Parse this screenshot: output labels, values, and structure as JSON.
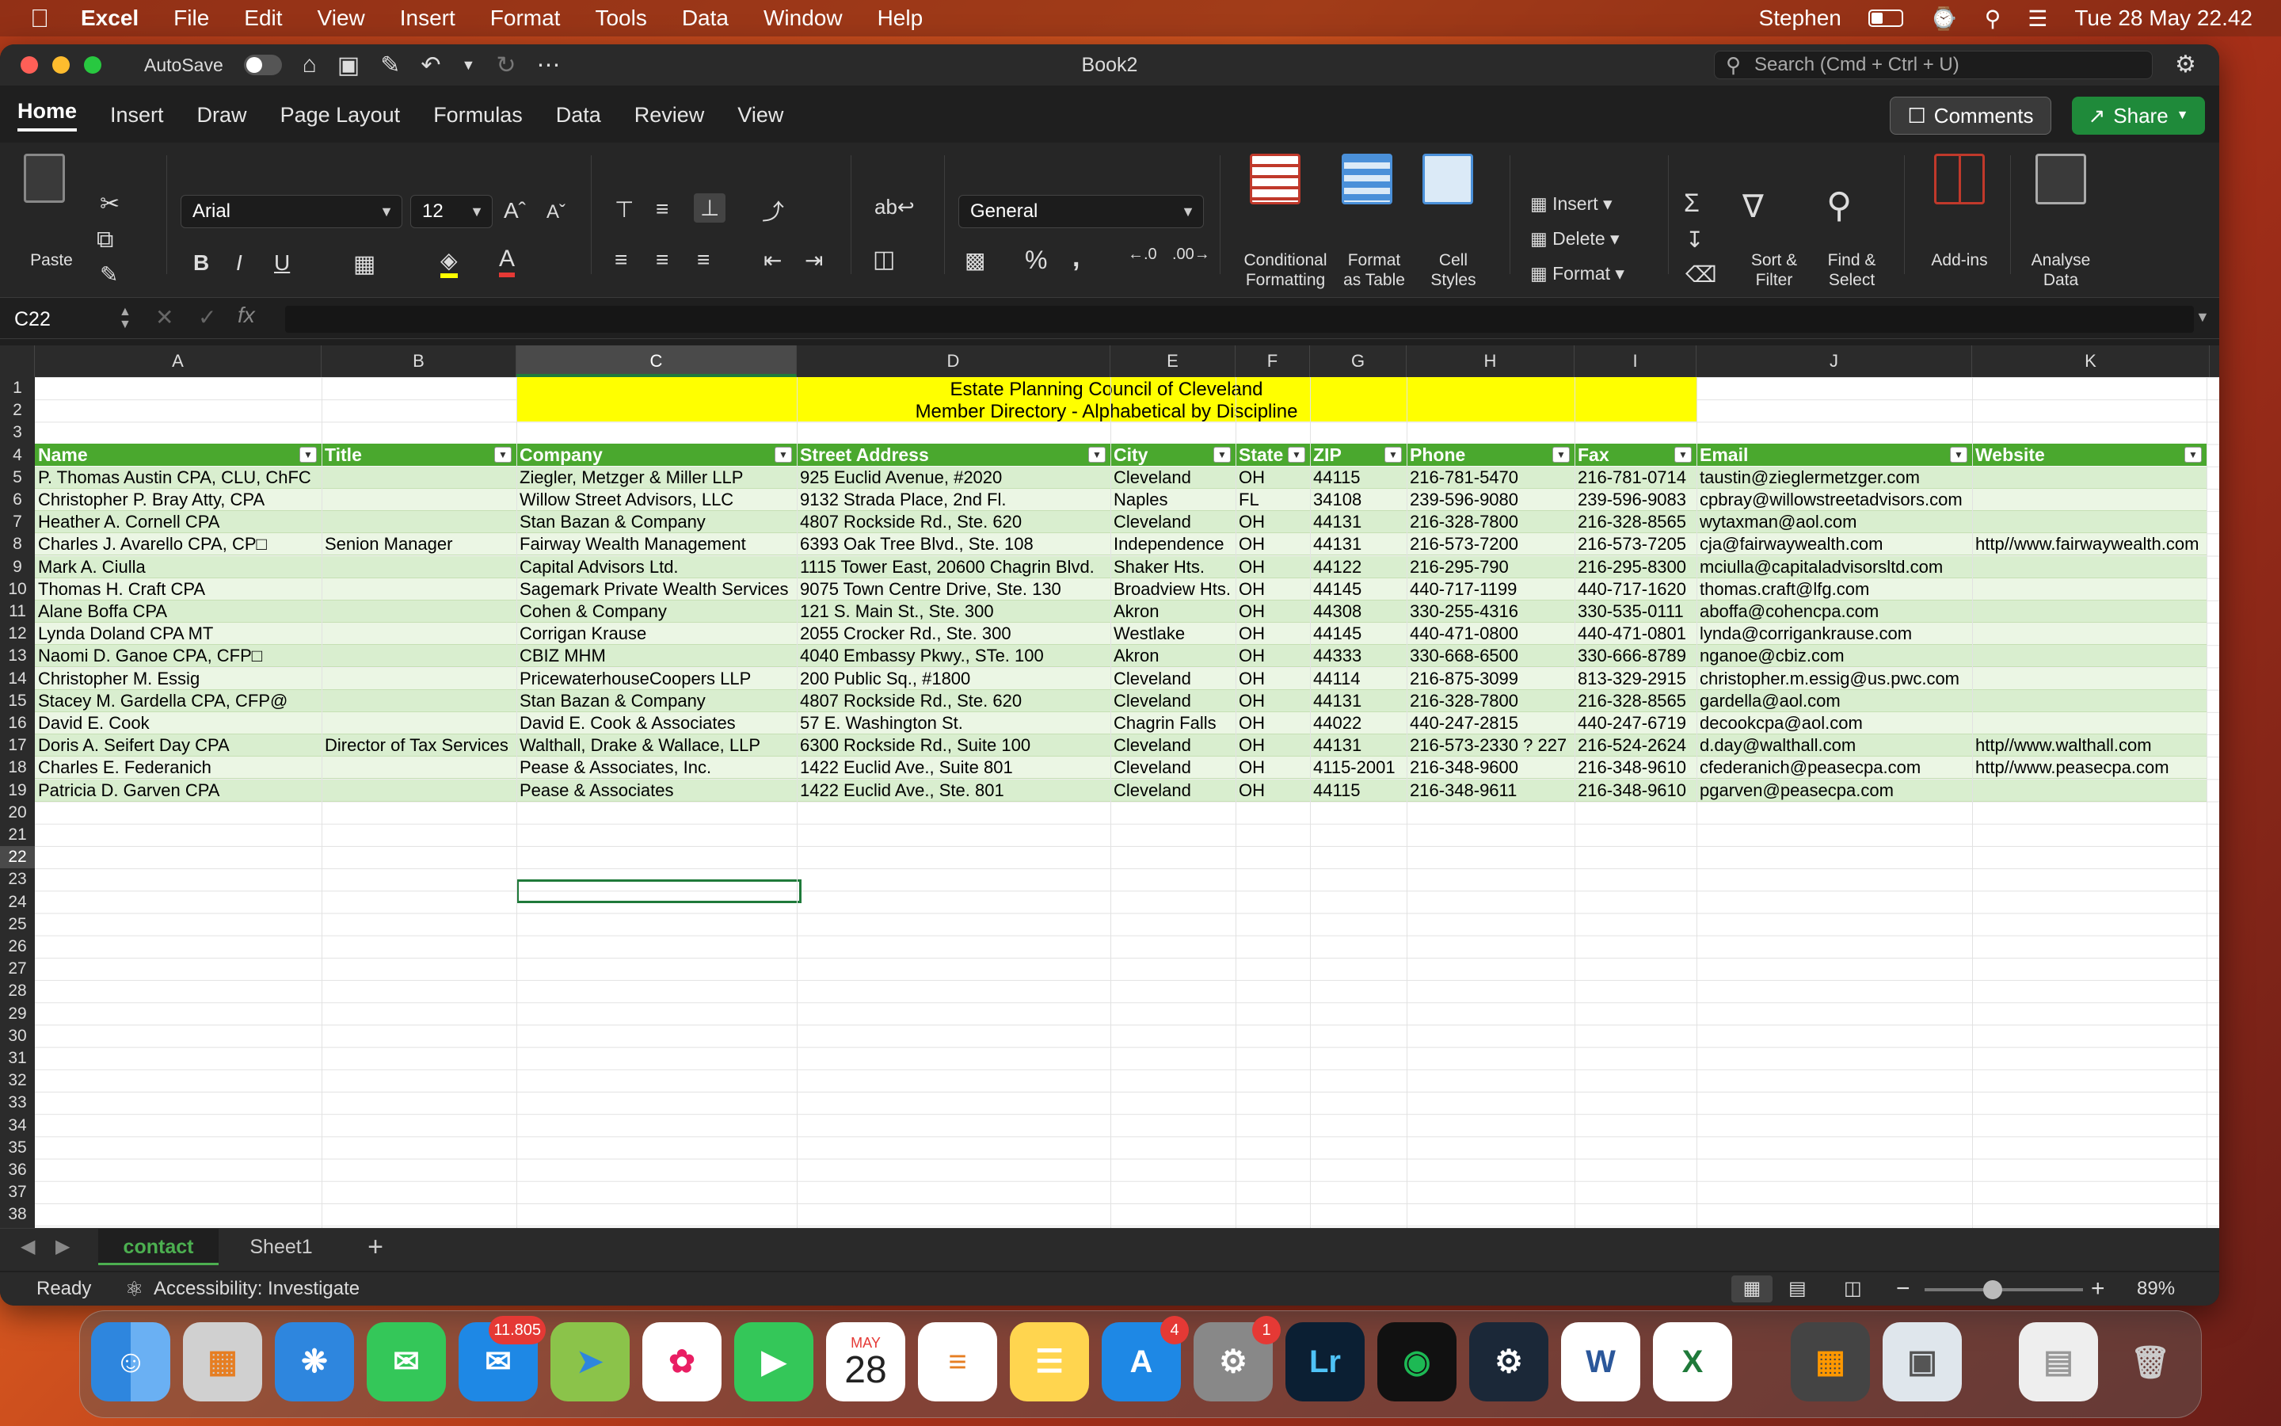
{
  "menubar": {
    "app": "Excel",
    "items": [
      "File",
      "Edit",
      "View",
      "Insert",
      "Format",
      "Tools",
      "Data",
      "Window",
      "Help"
    ],
    "user": "Stephen",
    "datetime": "Tue 28 May  22.42"
  },
  "window": {
    "autosave": "AutoSave",
    "title": "Book2",
    "search_placeholder": "Search (Cmd + Ctrl + U)"
  },
  "tabs": [
    "Home",
    "Insert",
    "Draw",
    "Page Layout",
    "Formulas",
    "Data",
    "Review",
    "View"
  ],
  "actions": {
    "comments": "Comments",
    "share": "Share"
  },
  "ribbon": {
    "paste": "Paste",
    "font": "Arial",
    "size": "12",
    "number_format": "General",
    "conditional": [
      "Conditional",
      "Formatting"
    ],
    "format_table": [
      "Format",
      "as Table"
    ],
    "cell_styles": [
      "Cell",
      "Styles"
    ],
    "insert": "Insert",
    "delete": "Delete",
    "format": "Format",
    "sort": [
      "Sort &",
      "Filter"
    ],
    "find": [
      "Find &",
      "Select"
    ],
    "addins": "Add-ins",
    "analyse": [
      "Analyse",
      "Data"
    ]
  },
  "formula": {
    "cell": "C22",
    "fx": "fx"
  },
  "columns": [
    "A",
    "B",
    "C",
    "D",
    "E",
    "F",
    "G",
    "H",
    "I",
    "J",
    "K"
  ],
  "banner": {
    "line1": "Estate Planning Council of Cleveland",
    "line2": "Member Directory - Alphabetical by Discipline"
  },
  "headers": [
    "Name",
    "Title",
    "Company",
    "Street Address",
    "City",
    "State",
    "ZIP",
    "Phone",
    "Fax",
    "Email",
    "Website"
  ],
  "rows": [
    [
      "P. Thomas Austin CPA, CLU, ChFC",
      "",
      "Ziegler, Metzger & Miller LLP",
      "925 Euclid Avenue, #2020",
      "Cleveland",
      "OH",
      "44115",
      "216-781-5470",
      "216-781-0714",
      "taustin@zieglermetzger.com",
      ""
    ],
    [
      "Christopher P. Bray Atty, CPA",
      "",
      "Willow Street Advisors, LLC",
      "9132 Strada Place, 2nd Fl.",
      "Naples",
      "FL",
      "34108",
      "239-596-9080",
      "239-596-9083",
      "cpbray@willowstreetadvisors.com",
      ""
    ],
    [
      "Heather A. Cornell CPA",
      "",
      "Stan Bazan & Company",
      "4807 Rockside Rd., Ste. 620",
      "Cleveland",
      "OH",
      "44131",
      "216-328-7800",
      "216-328-8565",
      "wytaxman@aol.com",
      ""
    ],
    [
      "Charles J. Avarello CPA, CP□",
      "Senion Manager",
      "Fairway Wealth Management",
      "6393 Oak Tree Blvd., Ste. 108",
      "Independence",
      "OH",
      "44131",
      "216-573-7200",
      "216-573-7205",
      "cja@fairwaywealth.com",
      "http//www.fairwaywealth.com"
    ],
    [
      "Mark A. Ciulla",
      "",
      "Capital Advisors Ltd.",
      "1115 Tower East, 20600 Chagrin Blvd.",
      "Shaker Hts.",
      "OH",
      "44122",
      "216-295-790",
      "216-295-8300",
      "mciulla@capitaladvisorsltd.com",
      ""
    ],
    [
      "Thomas H. Craft CPA",
      "",
      "Sagemark Private Wealth Services",
      "9075 Town Centre Drive, Ste. 130",
      "Broadview Hts.",
      "OH",
      "44145",
      "440-717-1199",
      "440-717-1620",
      "thomas.craft@lfg.com",
      ""
    ],
    [
      "Alane Boffa CPA",
      "",
      "Cohen & Company",
      "121 S. Main St., Ste. 300",
      "Akron",
      "OH",
      "44308",
      "330-255-4316",
      "330-535-0111",
      "aboffa@cohencpa.com",
      ""
    ],
    [
      "Lynda Doland CPA MT",
      "",
      "Corrigan Krause",
      "2055 Crocker Rd., Ste. 300",
      "Westlake",
      "OH",
      "44145",
      "440-471-0800",
      "440-471-0801",
      "lynda@corrigankrause.com",
      ""
    ],
    [
      "Naomi D. Ganoe CPA, CFP□",
      "",
      "CBIZ MHM",
      "4040 Embassy Pkwy., STe. 100",
      "Akron",
      "OH",
      "44333",
      "330-668-6500",
      "330-666-8789",
      "nganoe@cbiz.com",
      ""
    ],
    [
      "Christopher M. Essig",
      "",
      "PricewaterhouseCoopers LLP",
      "200 Public Sq., #1800",
      "Cleveland",
      "OH",
      "44114",
      "216-875-3099",
      "813-329-2915",
      "christopher.m.essig@us.pwc.com",
      ""
    ],
    [
      "Stacey M. Gardella CPA, CFP@",
      "",
      "Stan Bazan & Company",
      "4807 Rockside Rd., Ste. 620",
      "Cleveland",
      "OH",
      "44131",
      "216-328-7800",
      "216-328-8565",
      "gardella@aol.com",
      ""
    ],
    [
      "David E. Cook",
      "",
      "David E. Cook & Associates",
      "57 E. Washington St.",
      "Chagrin Falls",
      "OH",
      "44022",
      "440-247-2815",
      "440-247-6719",
      "decookcpa@aol.com",
      ""
    ],
    [
      "Doris A. Seifert Day CPA",
      "Director of Tax Services",
      "Walthall, Drake & Wallace, LLP",
      "6300 Rockside Rd., Suite 100",
      "Cleveland",
      "OH",
      "44131",
      "216-573-2330 ? 227",
      "216-524-2624",
      "d.day@walthall.com",
      "http//www.walthall.com"
    ],
    [
      "Charles E. Federanich",
      "",
      "Pease & Associates, Inc.",
      "1422 Euclid Ave., Suite 801",
      "Cleveland",
      "OH",
      "4115-2001",
      "216-348-9600",
      "216-348-9610",
      "cfederanich@peasecpa.com",
      "http//www.peasecpa.com"
    ],
    [
      "Patricia D. Garven CPA",
      "",
      "Pease & Associates",
      "1422 Euclid Ave., Ste. 801",
      "Cleveland",
      "OH",
      "44115",
      "216-348-9611",
      "216-348-9610",
      "pgarven@peasecpa.com",
      ""
    ]
  ],
  "sheets": [
    "contact",
    "Sheet1"
  ],
  "status": {
    "ready": "Ready",
    "accessibility": "Accessibility: Investigate",
    "zoom": "89%"
  },
  "dock": {
    "mail_badge": "11.805",
    "calendar_month": "MAY",
    "calendar_day": "28",
    "appstore_badge": "4",
    "settings_badge": "1"
  }
}
